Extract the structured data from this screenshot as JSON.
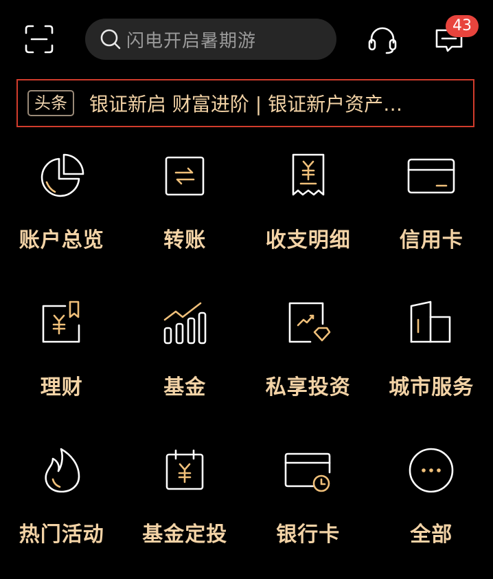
{
  "topbar": {
    "search_placeholder": "闪电开启暑期游",
    "message_count": "43"
  },
  "headline": {
    "tag": "头条",
    "text": "银证新启 财富进阶 | 银证新户资产…"
  },
  "grid": {
    "rows": [
      [
        {
          "label": "账户总览",
          "icon": "pie-chart-icon"
        },
        {
          "label": "转账",
          "icon": "transfer-icon"
        },
        {
          "label": "收支明细",
          "icon": "receipt-icon"
        },
        {
          "label": "信用卡",
          "icon": "credit-card-icon"
        }
      ],
      [
        {
          "label": "理财",
          "icon": "wealth-icon"
        },
        {
          "label": "基金",
          "icon": "fund-chart-icon"
        },
        {
          "label": "私享投资",
          "icon": "private-investment-icon"
        },
        {
          "label": "城市服务",
          "icon": "city-buildings-icon"
        }
      ],
      [
        {
          "label": "热门活动",
          "icon": "flame-icon"
        },
        {
          "label": "基金定投",
          "icon": "calendar-yen-icon"
        },
        {
          "label": "银行卡",
          "icon": "bank-card-clock-icon"
        },
        {
          "label": "全部",
          "icon": "more-icon"
        }
      ]
    ]
  }
}
